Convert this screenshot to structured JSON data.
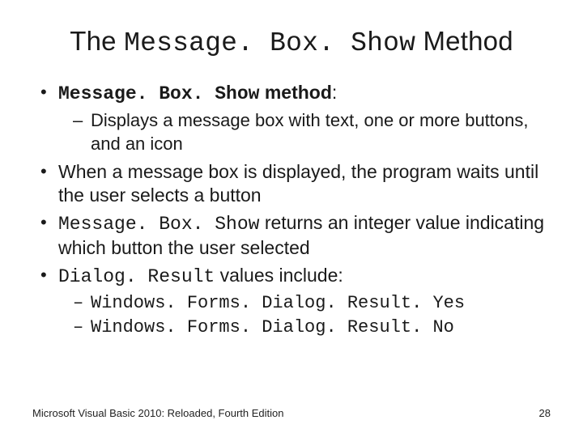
{
  "title": {
    "pre": "The ",
    "code": "Message. Box. Show",
    "post": " Method"
  },
  "bullets": {
    "b1": {
      "code": "Message. Box. Show",
      "bold_post": " method",
      "post": ":",
      "sub1": "Displays a message box with text, one or more buttons, and an icon"
    },
    "b2": "When a message box is displayed, the program waits until the user selects a button",
    "b3": {
      "code": "Message. Box. Show",
      "post": " returns an integer value indicating which button the user selected"
    },
    "b4": {
      "code": "Dialog. Result",
      "post": " values include:",
      "sub1": "Windows. Forms. Dialog. Result. Yes",
      "sub2": "Windows. Forms. Dialog. Result. No"
    }
  },
  "footer": {
    "book": "Microsoft Visual Basic 2010: Reloaded, Fourth Edition",
    "page": "28"
  }
}
